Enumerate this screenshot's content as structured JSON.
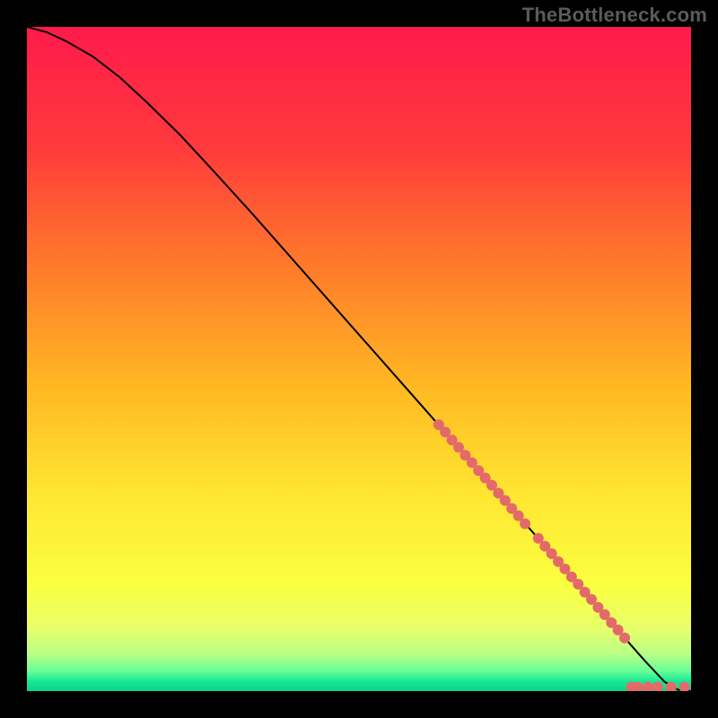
{
  "watermark": "TheBottleneck.com",
  "chart_data": {
    "type": "line",
    "title": "",
    "xlabel": "",
    "ylabel": "",
    "xlim": [
      0,
      100
    ],
    "ylim": [
      0,
      100
    ],
    "background_gradient": {
      "stops": [
        {
          "offset": 0.0,
          "color": "#ff1a4c"
        },
        {
          "offset": 0.18,
          "color": "#ff3a3c"
        },
        {
          "offset": 0.36,
          "color": "#ff7a2a"
        },
        {
          "offset": 0.54,
          "color": "#ffb822"
        },
        {
          "offset": 0.7,
          "color": "#ffe531"
        },
        {
          "offset": 0.84,
          "color": "#fbff40"
        },
        {
          "offset": 0.905,
          "color": "#e8ff6a"
        },
        {
          "offset": 0.945,
          "color": "#b7ff86"
        },
        {
          "offset": 0.97,
          "color": "#66ff99"
        },
        {
          "offset": 0.985,
          "color": "#18e896"
        },
        {
          "offset": 1.0,
          "color": "#0ad489"
        }
      ]
    },
    "series": [
      {
        "name": "curve",
        "type": "line",
        "color": "#000000",
        "width": 2,
        "x": [
          0,
          3,
          6,
          10,
          14,
          18,
          23,
          28,
          34,
          40,
          46,
          52,
          58,
          64,
          69,
          74,
          78,
          82,
          86,
          90,
          93,
          96,
          98,
          100
        ],
        "y": [
          100,
          99.2,
          97.8,
          95.5,
          92.4,
          88.7,
          83.8,
          78.4,
          71.8,
          65.0,
          58.2,
          51.4,
          44.6,
          37.8,
          32.1,
          26.4,
          21.8,
          17.2,
          12.6,
          8.0,
          4.6,
          1.4,
          0.2,
          0
        ]
      },
      {
        "name": "dots",
        "type": "scatter",
        "color": "#e46a6a",
        "radius": 6,
        "x": [
          62,
          63,
          64,
          65,
          66,
          67,
          68,
          69,
          70,
          71,
          72,
          73,
          74,
          75,
          77,
          78,
          79,
          80,
          81,
          82,
          83,
          84,
          85,
          86,
          87,
          88,
          89,
          90,
          91,
          92,
          93.5,
          95,
          97,
          99
        ],
        "y": [
          40.1,
          39.0,
          37.8,
          36.7,
          35.5,
          34.4,
          33.2,
          32.1,
          31.0,
          29.8,
          28.7,
          27.5,
          26.4,
          25.2,
          23.0,
          21.8,
          20.7,
          19.5,
          18.4,
          17.2,
          16.1,
          14.9,
          13.8,
          12.6,
          11.5,
          10.3,
          9.2,
          8.0,
          0.6,
          0.6,
          0.6,
          0.6,
          0.6,
          0.6
        ]
      }
    ]
  }
}
